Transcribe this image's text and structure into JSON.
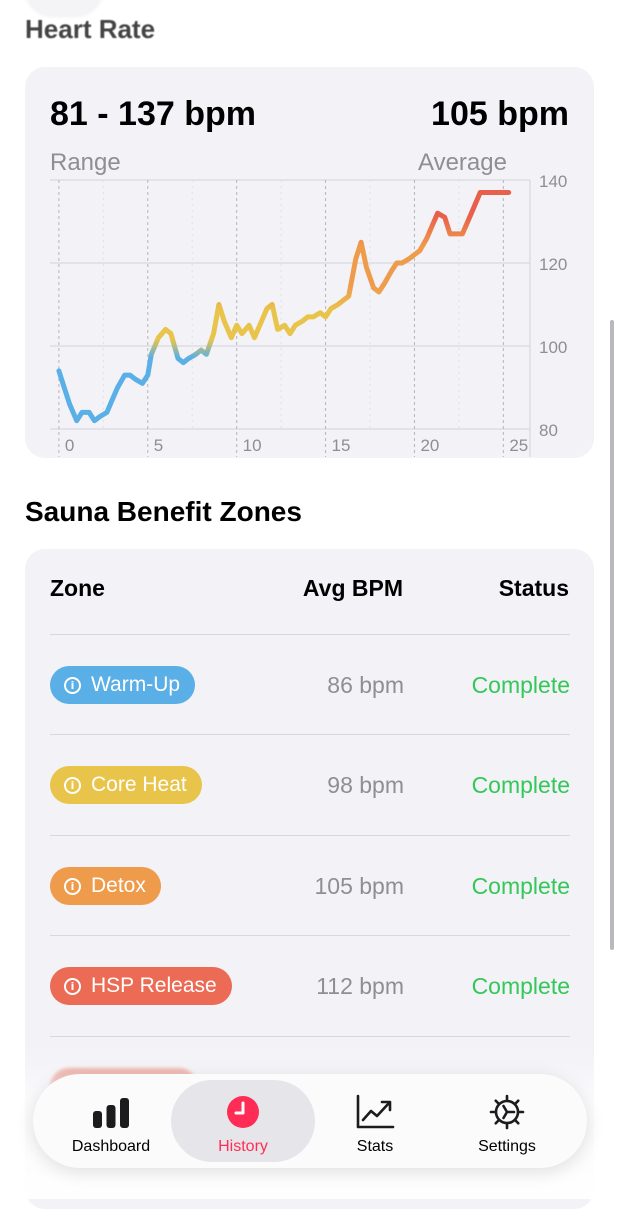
{
  "heart_rate": {
    "title": "Heart Rate",
    "range_value": "81 - 137 bpm",
    "range_label": "Range",
    "average_value": "105 bpm",
    "average_label": "Average"
  },
  "chart_data": {
    "type": "line",
    "title": "",
    "xlabel": "",
    "ylabel": "",
    "x_ticks": [
      "0",
      "5",
      "10",
      "15",
      "20",
      "25"
    ],
    "y_ticks": [
      "140",
      "120",
      "100",
      "80"
    ],
    "xlim": [
      -0.5,
      26.5
    ],
    "ylim": [
      80,
      140
    ],
    "grid": true,
    "line_colors": {
      "blue": "#5aafe6",
      "yellow": "#e9c44a",
      "orange": "#ef9b4c",
      "red": "#e8604c"
    },
    "series": [
      {
        "x": [
          0,
          0.3,
          0.6,
          1.0,
          1.3,
          1.7,
          2.0,
          2.3,
          2.7,
          3.0,
          3.3,
          3.7,
          4.0,
          4.3,
          4.7,
          5.0,
          5.2,
          5.4,
          5.6,
          6.0,
          6.3,
          6.7,
          7.0,
          7.3,
          7.7,
          8.0,
          8.3,
          8.7,
          9.0,
          9.3,
          9.7,
          10.0,
          10.3,
          10.7,
          11.0,
          11.3,
          11.7,
          12.0,
          12.3,
          12.7,
          13.0,
          13.3,
          13.7,
          14.0,
          14.3,
          14.7,
          15.0,
          15.3,
          15.7,
          16.0,
          16.3,
          16.7,
          17.0,
          17.3,
          17.7,
          18.0,
          18.3,
          18.7,
          19.0,
          19.3,
          19.7,
          20.0,
          20.3,
          20.7,
          21.0,
          21.3,
          21.7,
          22.0,
          22.3,
          22.7,
          23.0,
          23.3,
          23.7,
          24.0,
          24.3,
          24.7,
          25.0,
          25.3
        ],
        "y": [
          94,
          90,
          86,
          82,
          84,
          84,
          82,
          83,
          84,
          87,
          90,
          93,
          93,
          92,
          91,
          93,
          98,
          100,
          102,
          104,
          103,
          97,
          96,
          97,
          98,
          99,
          98,
          103,
          110,
          106,
          102,
          105,
          103,
          105,
          102,
          105,
          109,
          110,
          104,
          105,
          103,
          105,
          106,
          107,
          107,
          108,
          107,
          109,
          110,
          111,
          112,
          121,
          125,
          119,
          114,
          113,
          115,
          118,
          120,
          120,
          121,
          122,
          123,
          126,
          129,
          132,
          131,
          127,
          127,
          127,
          130,
          133,
          137,
          137,
          137,
          137,
          137,
          137
        ]
      }
    ]
  },
  "zones": {
    "title": "Sauna Benefit Zones",
    "headers": {
      "zone": "Zone",
      "bpm": "Avg BPM",
      "status": "Status"
    },
    "rows": [
      {
        "name": "Warm-Up",
        "bpm": "86 bpm",
        "status": "Complete",
        "color": "#5aafe6"
      },
      {
        "name": "Core Heat",
        "bpm": "98 bpm",
        "status": "Complete",
        "color": "#e9c44a"
      },
      {
        "name": "Detox",
        "bpm": "105 bpm",
        "status": "Complete",
        "color": "#ef9b4c"
      },
      {
        "name": "HSP Release",
        "bpm": "112 bpm",
        "status": "Complete",
        "color": "#ec6b55"
      }
    ]
  },
  "tabbar": {
    "dashboard": {
      "label": "Dashboard",
      "icon": "bar-chart-icon"
    },
    "history": {
      "label": "History",
      "icon": "clock-icon"
    },
    "stats": {
      "label": "Stats",
      "icon": "trend-chart-icon"
    },
    "settings": {
      "label": "Settings",
      "icon": "gear-icon"
    }
  },
  "accent_color": "#ff2d55"
}
